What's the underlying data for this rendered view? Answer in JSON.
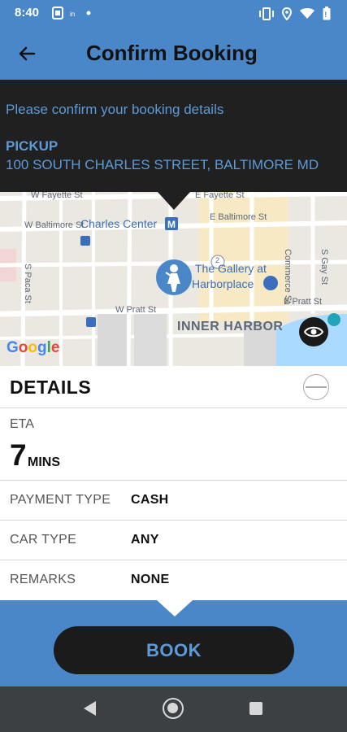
{
  "status_bar": {
    "time": "8:40",
    "icons": [
      "notification-icon",
      "app-icon",
      "dot-icon",
      "vibrate-icon",
      "location-icon",
      "wifi-icon",
      "battery-icon"
    ]
  },
  "app_bar": {
    "title": "Confirm Booking",
    "back_icon": "arrow-left-icon"
  },
  "info": {
    "confirm_text": "Please confirm your booking details",
    "pickup_label": "PICKUP",
    "pickup_address": "100 SOUTH CHARLES STREET, BALTIMORE MD"
  },
  "map": {
    "labels": {
      "w_fayette": "W Fayette St",
      "e_fayette": "E Fayette St",
      "w_baltimore": "W Baltimore St",
      "e_baltimore": "E Baltimore St",
      "charles_center": "Charles Center",
      "gallery_line1": "The Gallery at",
      "gallery_line2": "Harborplace",
      "w_pratt": "W Pratt St",
      "e_pratt": "E Pratt St",
      "inner_harbor": "INNER HARBOR",
      "commerce": "Commerce St",
      "s_gay": "S Gay St",
      "s_paca": "S Paca St",
      "route": "2"
    },
    "google": "Google"
  },
  "details": {
    "title": "DETAILS",
    "eta_label": "ETA",
    "eta_value": "7",
    "eta_unit": "MINS",
    "rows": [
      {
        "label": "PAYMENT TYPE",
        "value": "CASH"
      },
      {
        "label": "CAR TYPE",
        "value": "ANY"
      },
      {
        "label": "REMARKS",
        "value": "NONE"
      }
    ]
  },
  "book_label": "BOOK",
  "colors": {
    "primary": "#4a87c8",
    "dark": "#202020",
    "accent_text": "#5c9ad8"
  }
}
